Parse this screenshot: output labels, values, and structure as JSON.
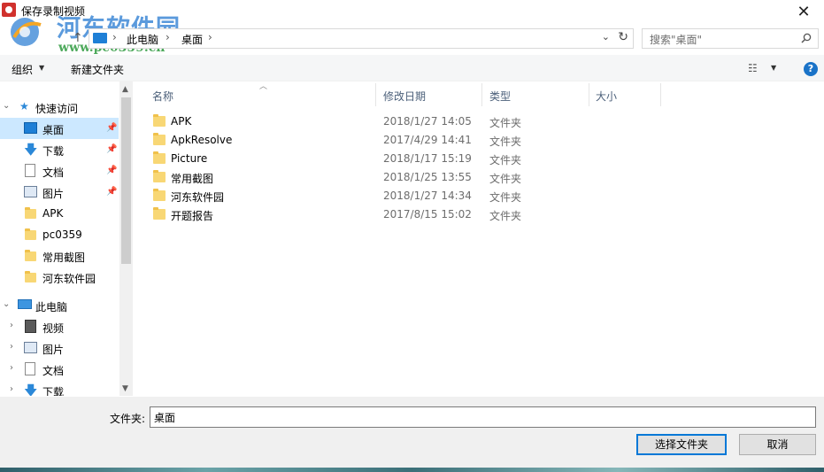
{
  "window": {
    "title": "保存录制视频",
    "close_glyph": "✕"
  },
  "watermark": {
    "title": "河东软件园",
    "url": "www.pc0359.cn"
  },
  "address_bar": {
    "up_glyph": "↑",
    "segments": [
      "此电脑",
      "桌面"
    ],
    "separator": "›",
    "dropdown_glyph": "⌄",
    "refresh_glyph": "↻"
  },
  "search": {
    "placeholder": "搜索\"桌面\""
  },
  "toolbar": {
    "organize_label": "组织",
    "caret": "▼",
    "new_folder_label": "新建文件夹",
    "view_glyph": "☷",
    "help_glyph": "?"
  },
  "nav": {
    "quick_access": {
      "label": "快速访问"
    },
    "items": [
      {
        "label": "桌面",
        "icon": "desktop-icon",
        "pinned": true,
        "selected": true
      },
      {
        "label": "下载",
        "icon": "download-arrow-icon",
        "pinned": true
      },
      {
        "label": "文档",
        "icon": "document-icon",
        "pinned": true
      },
      {
        "label": "图片",
        "icon": "picture-icon",
        "pinned": true
      },
      {
        "label": "APK",
        "icon": "folder-icon"
      },
      {
        "label": "pc0359",
        "icon": "folder-icon"
      },
      {
        "label": "常用截图",
        "icon": "folder-icon"
      },
      {
        "label": "河东软件园",
        "icon": "folder-icon"
      }
    ],
    "this_pc": {
      "label": "此电脑"
    },
    "pc_items": [
      {
        "label": "视频",
        "icon": "video-icon"
      },
      {
        "label": "图片",
        "icon": "picture-icon"
      },
      {
        "label": "文档",
        "icon": "document-icon"
      },
      {
        "label": "下载",
        "icon": "download-arrow-icon"
      }
    ],
    "pin_glyph": "📌",
    "expand_glyph": "›",
    "collapse_glyph": "⌄"
  },
  "file_list": {
    "columns": {
      "name": "名称",
      "modified": "修改日期",
      "type": "类型",
      "size": "大小"
    },
    "rows": [
      {
        "name": "APK",
        "modified": "2018/1/27 14:05",
        "type": "文件夹"
      },
      {
        "name": "ApkResolve",
        "modified": "2017/4/29 14:41",
        "type": "文件夹"
      },
      {
        "name": "Picture",
        "modified": "2018/1/17 15:19",
        "type": "文件夹"
      },
      {
        "name": "常用截图",
        "modified": "2018/1/25 13:55",
        "type": "文件夹"
      },
      {
        "name": "河东软件园",
        "modified": "2018/1/27 14:34",
        "type": "文件夹"
      },
      {
        "name": "开题报告",
        "modified": "2017/8/15 15:02",
        "type": "文件夹"
      }
    ]
  },
  "bottom": {
    "folder_label": "文件夹:",
    "folder_value": "桌面",
    "select_button": "选择文件夹",
    "cancel_button": "取消"
  },
  "colors": {
    "accent": "#0078d7",
    "selection": "#cce8ff",
    "folder": "#f8d775",
    "header_text": "#4c607a"
  }
}
